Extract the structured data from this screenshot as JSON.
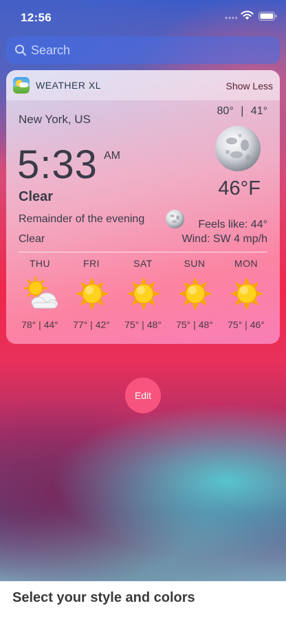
{
  "status_bar": {
    "time": "12:56"
  },
  "search": {
    "placeholder": "Search"
  },
  "widget": {
    "app_name": "WEATHER XL",
    "toggle_label": "Show Less",
    "location": "New York, US",
    "high": "80°",
    "separator": "|",
    "low": "41°",
    "time": "5:33",
    "ampm": "AM",
    "condition": "Clear",
    "current_temp": "46°F",
    "remainder_label": "Remainder of the evening",
    "remainder_condition": "Clear",
    "feels_like": "Feels like: 44°",
    "wind": "Wind: SW 4 mp/h",
    "forecast": [
      {
        "day": "THU",
        "icon": "partly-cloudy-icon",
        "temps": "78° | 44°"
      },
      {
        "day": "FRI",
        "icon": "sun-icon",
        "temps": "77° | 42°"
      },
      {
        "day": "SAT",
        "icon": "sun-icon",
        "temps": "75° | 48°"
      },
      {
        "day": "SUN",
        "icon": "sun-icon",
        "temps": "75° | 48°"
      },
      {
        "day": "MON",
        "icon": "sun-icon",
        "temps": "75° | 46°"
      }
    ]
  },
  "edit_label": "Edit",
  "caption": "Select your style and colors"
}
